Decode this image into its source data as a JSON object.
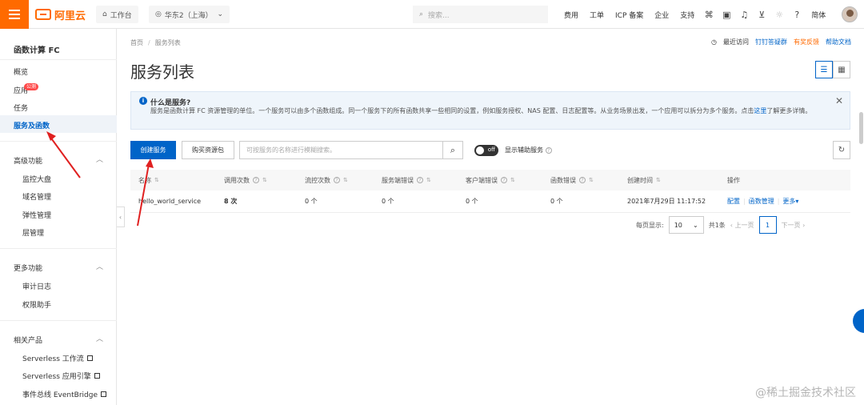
{
  "topbar": {
    "logo": "阿里云",
    "workbench": "工作台",
    "region": "华东2（上海）",
    "search_placeholder": "搜索...",
    "nav": [
      "费用",
      "工单",
      "ICP 备案",
      "企业",
      "支持"
    ],
    "lang": "简体"
  },
  "sidebar": {
    "title": "函数计算 FC",
    "items": [
      "概览",
      "应用",
      "任务",
      "服务及函数"
    ],
    "app_badge": "公测",
    "advanced_group": "高级功能",
    "advanced_items": [
      "监控大盘",
      "域名管理",
      "弹性管理",
      "层管理"
    ],
    "more_group": "更多功能",
    "more_items": [
      "审计日志",
      "权限助手"
    ],
    "related_group": "相关产品",
    "related_items": [
      "Serverless 工作流",
      "Serverless 应用引擎",
      "事件总线 EventBridge"
    ]
  },
  "main": {
    "breadcrumb": [
      "首页",
      "服务列表"
    ],
    "links": {
      "recent": "最近访问",
      "dingtalk": "钉钉答疑群",
      "feedback": "有奖反馈",
      "docs": "帮助文档"
    },
    "title": "服务列表",
    "info": {
      "title": "什么是服务?",
      "body": "服务是函数计算 FC 资源管理的单位。一个服务可以由多个函数组成。同一个服务下的所有函数共享一些相同的设置，例如服务授权、NAS 配置、日志配置等。从业务场景出发，一个应用可以拆分为多个服务。点击",
      "link": "这里",
      "body_tail": "了解更多详情。"
    },
    "actions": {
      "create": "创建服务",
      "buy": "购买资源包",
      "search_placeholder": "可按服务的名称进行模糊搜索。",
      "toggle": "off",
      "toggle_label": "显示辅助服务"
    },
    "table": {
      "headers": [
        "名称",
        "调用次数",
        "流控次数",
        "服务端错误",
        "客户端错误",
        "函数错误",
        "创建时间",
        "操作"
      ],
      "rows": [
        {
          "name": "hello_world_service",
          "calls": "8 次",
          "throttle": "0 个",
          "server_err": "0 个",
          "client_err": "0 个",
          "func_err": "0 个",
          "created": "2021年7月29日 11:17:52",
          "op1": "配置",
          "op2": "函数管理",
          "op3": "更多"
        }
      ]
    },
    "pager": {
      "per_page_label": "每页显示:",
      "per_page": "10",
      "total": "共1条",
      "prev": "上一页",
      "page": "1",
      "next": "下一页"
    }
  },
  "watermark": "@稀土掘金技术社区",
  "colors": {
    "brand": "#ff6a00",
    "primary": "#0064c8",
    "annotation": "#e02020"
  }
}
